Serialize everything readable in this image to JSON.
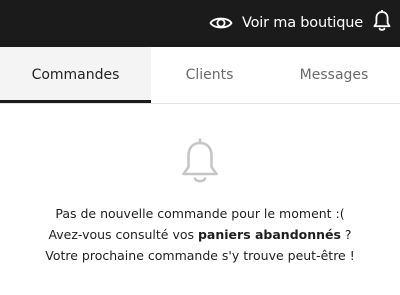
{
  "topbar": {
    "view_shop_label": "Voir ma boutique",
    "view_shop_icon": "eye-icon",
    "notifications_icon": "bell-icon",
    "background": "#1b1b1b"
  },
  "tabs": [
    {
      "label": "Commandes",
      "active": true
    },
    {
      "label": "Clients",
      "active": false
    },
    {
      "label": "Messages",
      "active": false
    }
  ],
  "empty_state": {
    "icon": "bell-outline-icon",
    "line1": "Pas de nouvelle commande pour le moment :(",
    "line2_prefix": "Avez-vous consulté vos ",
    "line2_bold": "paniers abandonnés",
    "line2_suffix": " ?",
    "line3": "Votre prochaine commande s'y trouve peut-être !"
  }
}
